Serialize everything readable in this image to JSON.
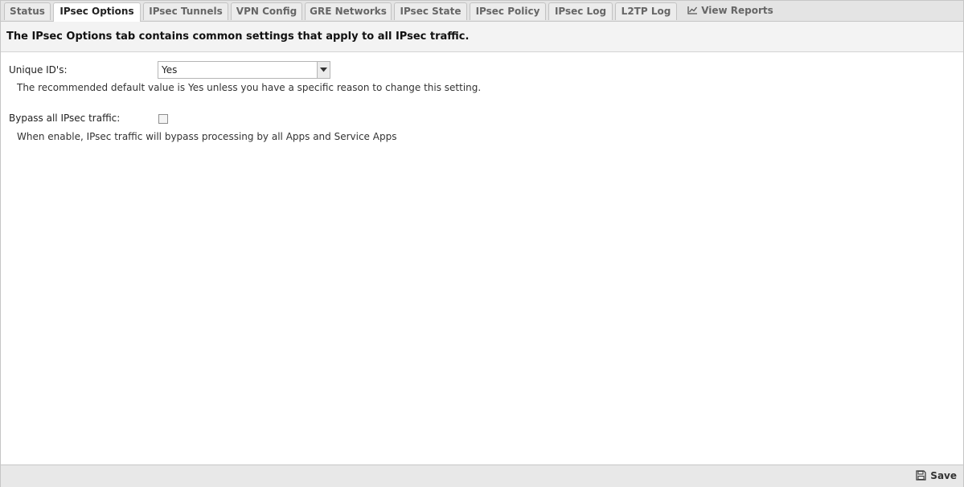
{
  "tabs": [
    {
      "label": "Status",
      "active": false
    },
    {
      "label": "IPsec Options",
      "active": true
    },
    {
      "label": "IPsec Tunnels",
      "active": false
    },
    {
      "label": "VPN Config",
      "active": false
    },
    {
      "label": "GRE Networks",
      "active": false
    },
    {
      "label": "IPsec State",
      "active": false
    },
    {
      "label": "IPsec Policy",
      "active": false
    },
    {
      "label": "IPsec Log",
      "active": false
    },
    {
      "label": "L2TP Log",
      "active": false
    },
    {
      "label": "View Reports",
      "icon": "line-chart-icon",
      "active": false
    }
  ],
  "banner": "The IPsec Options tab contains common settings that apply to all IPsec traffic.",
  "unique_ids": {
    "label": "Unique ID's:",
    "value": "Yes",
    "help": "The recommended default value is Yes unless you have a specific reason to change this setting."
  },
  "bypass": {
    "label": "Bypass all IPsec traffic:",
    "checked": false,
    "help": "When enable, IPsec traffic will bypass processing by all Apps and Service Apps"
  },
  "footer": {
    "save_label": "Save",
    "save_icon": "save-icon"
  }
}
